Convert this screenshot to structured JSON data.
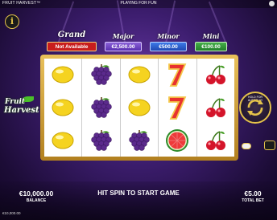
{
  "topbar": {
    "game_title": "FRUIT HARVEST™",
    "mode": "PLAYING FOR FUN"
  },
  "info_button": {
    "label": "i"
  },
  "jackpots": {
    "grand": {
      "name": "Grand",
      "value": "Not Available"
    },
    "major": {
      "name": "Major",
      "value": "€2,500.00"
    },
    "minor": {
      "name": "Minor",
      "value": "€500.00"
    },
    "mini": {
      "name": "Mini",
      "value": "€100.00"
    }
  },
  "logo": {
    "line1": "Fruit",
    "line2": "Harvest"
  },
  "line_numbers": {
    "left": [
      "4",
      "1",
      "3"
    ],
    "right": [
      "4",
      "1",
      "5"
    ]
  },
  "reels": [
    [
      "lemon",
      "lemon",
      "lemon"
    ],
    [
      "grapes",
      "grapes",
      "grapes"
    ],
    [
      "lemon",
      "lemon",
      "grapes"
    ],
    [
      "seven",
      "seven",
      "watermelon"
    ],
    [
      "cherries",
      "cherries",
      "cherries"
    ]
  ],
  "spin_button": {
    "ring_text": "HOLD FOR AUTOPLAY"
  },
  "bottom": {
    "balance_value": "€10,000.00",
    "balance_label": "BALANCE",
    "status_message": "HIT SPIN TO START GAME",
    "bet_value": "€5.00",
    "bet_label": "TOTAL BET",
    "footer_balance": "€10,000.00"
  },
  "colors": {
    "frame_gold": "#d8a63a",
    "grand_red": "#c81d1d",
    "major_purple": "#6a3fc0",
    "minor_blue": "#2a5ad0",
    "mini_green": "#2f9a36"
  }
}
